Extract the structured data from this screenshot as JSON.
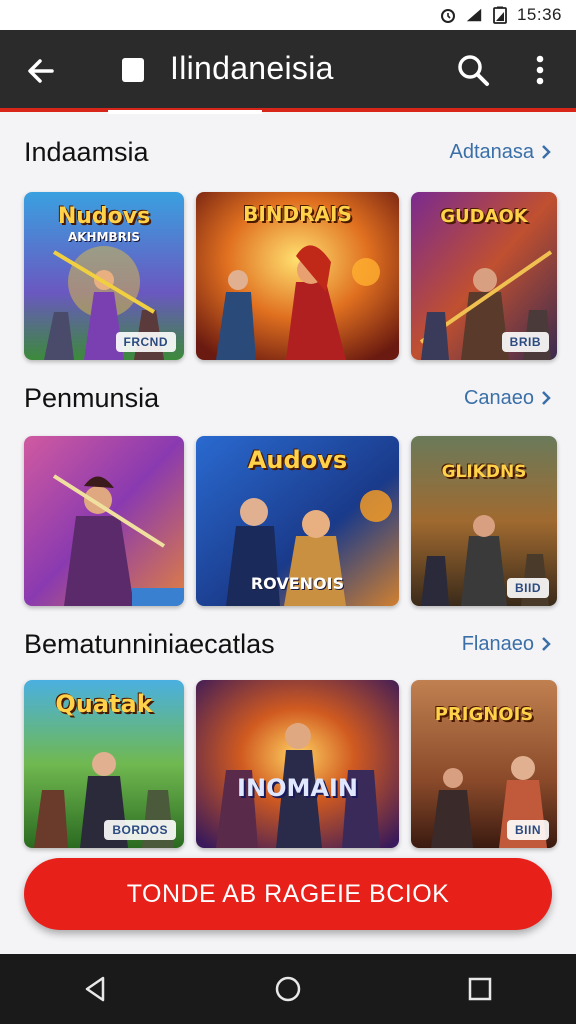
{
  "status_bar": {
    "time": "15:36"
  },
  "app_bar": {
    "title": "Ilindaneisia"
  },
  "sections": [
    {
      "title": "Indaamsia",
      "see_more": "Adtanasa",
      "cards": [
        {
          "title": "Nudovs",
          "subtitle": "AKHMBRIS",
          "badge": "FRCND"
        },
        {
          "title": "BINDRAIS",
          "subtitle": "",
          "badge": ""
        },
        {
          "title": "GUDAOK",
          "subtitle": "",
          "badge": "BRIB"
        }
      ]
    },
    {
      "title": "Penmunsia",
      "see_more": "Canaeo",
      "cards": [
        {
          "title": "",
          "subtitle": "",
          "badge": ""
        },
        {
          "title": "Audovs",
          "subtitle": "ROVENOIS",
          "badge": ""
        },
        {
          "title": "GLIKDNS",
          "subtitle": "",
          "badge": "BIID"
        }
      ]
    },
    {
      "title": "Bematunniniaecatlas",
      "see_more": "Flanaeo",
      "cards": [
        {
          "title": "Quatak",
          "subtitle": "",
          "badge": "BORDOS"
        },
        {
          "title": "INOMAIN",
          "subtitle": "",
          "badge": ""
        },
        {
          "title": "PRIGNOIS",
          "subtitle": "",
          "badge": "BIIN"
        }
      ]
    }
  ],
  "cta": {
    "label": "TONDE AB RAGEIE BCIOK"
  },
  "colors": {
    "accent": "#e8201a",
    "app_bar": "#2b2b2b",
    "link": "#3a6fa8"
  }
}
